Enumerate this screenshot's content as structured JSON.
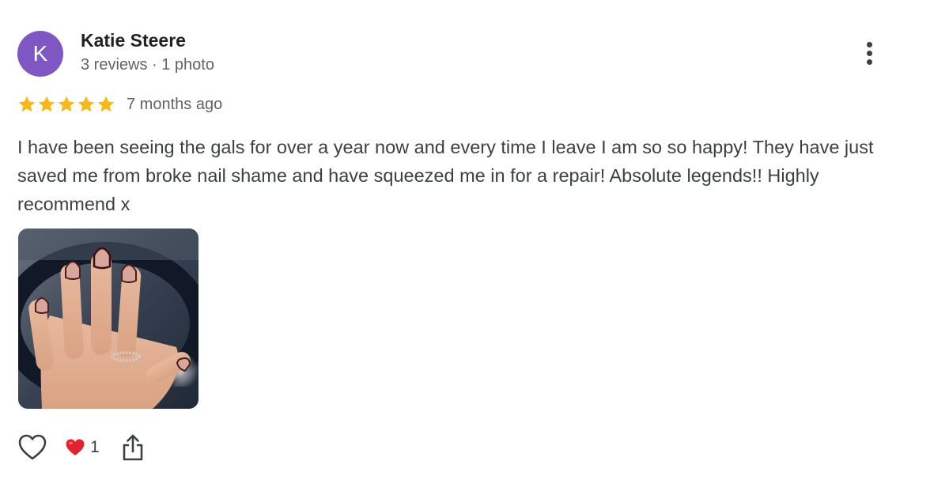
{
  "review": {
    "author": {
      "initial": "K",
      "name": "Katie Steere",
      "meta": "3 reviews · 1 photo",
      "avatar_color": "#7e57c2"
    },
    "rating": 5,
    "star_color": "#f6b91a",
    "timestamp": "7 months ago",
    "text": "I have been seeing the gals for over a year now and every time I leave I am so so happy! They have just saved me from broke nail shame and have squeezed me in for a repair! Absolute legends!! Highly recommend x",
    "photo": {
      "icon": "review-photo-hand-with-nails"
    },
    "actions": {
      "like_icon": "heart-outline-icon",
      "reaction_icon": "red-heart-emoji-icon",
      "reaction_count": "1",
      "share_icon": "share-icon"
    },
    "menu_icon": "more-vert-icon"
  }
}
